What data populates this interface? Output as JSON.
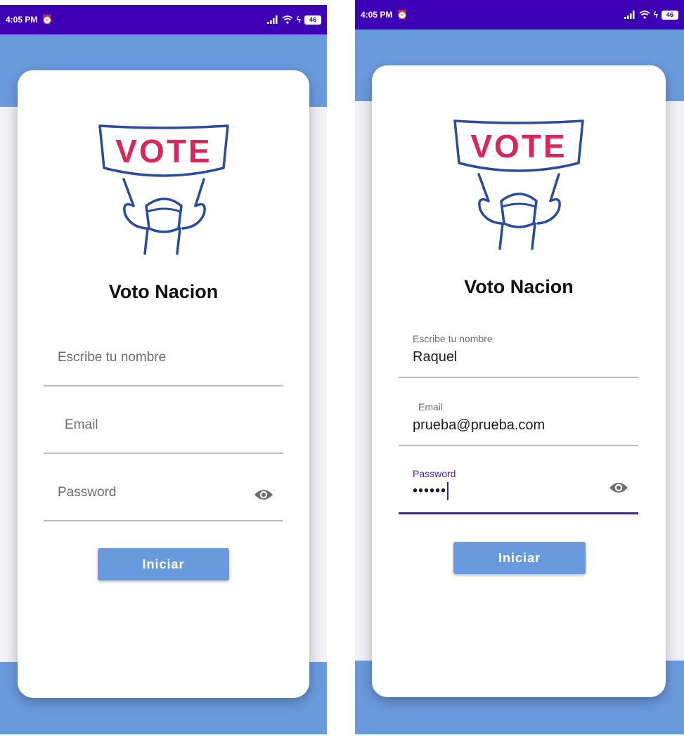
{
  "screens": [
    {
      "status": {
        "time": "4:05 PM",
        "battery": "46"
      },
      "app_title": "Voto Nacion",
      "logo_text": "VOTE",
      "name_field": {
        "label": "Escribe tu nombre",
        "value": ""
      },
      "email_field": {
        "label": "Email",
        "value": ""
      },
      "password_field": {
        "label": "Password",
        "value": ""
      },
      "submit_label": "Iniciar"
    },
    {
      "status": {
        "time": "4:05 PM",
        "battery": "46"
      },
      "app_title": "Voto Nacion",
      "logo_text": "VOTE",
      "name_field": {
        "label": "Escribe tu nombre",
        "value": "Raquel"
      },
      "email_field": {
        "label": "Email",
        "value": "prueba@prueba.com"
      },
      "password_field": {
        "label": "Password",
        "value": "••••••"
      },
      "submit_label": "Iniciar"
    }
  ],
  "colors": {
    "status_bar": "#3d00b5",
    "accent_band": "#6a9ade",
    "focus": "#4a1aa8",
    "logo_outline": "#2a4ca0",
    "logo_text": "#d8275a"
  },
  "icons": {
    "alarm": "alarm-icon",
    "signal": "signal-icon",
    "wifi": "wifi-icon",
    "eye": "visibility-eye-icon"
  }
}
